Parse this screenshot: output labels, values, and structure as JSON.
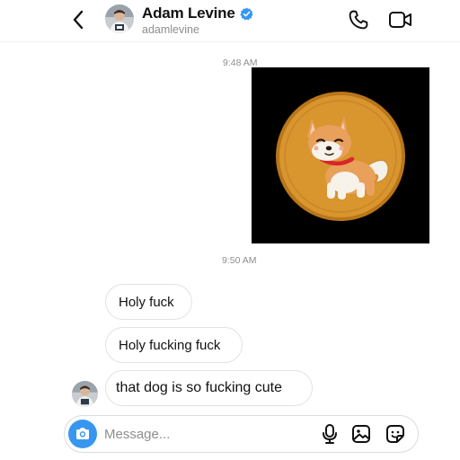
{
  "header": {
    "name": "Adam Levine",
    "username": "adamlevine",
    "verified": true,
    "icons": {
      "back": "chevron-left-icon",
      "verified": "verified-badge-icon",
      "call": "phone-icon",
      "video": "video-camera-icon"
    }
  },
  "conversation": {
    "timestamps": [
      "9:48 AM",
      "9:50 AM"
    ],
    "image_message": {
      "description_icon": "shiba-inu-coin-image"
    },
    "messages": [
      {
        "text": "Holy fuck"
      },
      {
        "text": "Holy fucking fuck"
      },
      {
        "text": "that dog is so fucking cute"
      }
    ]
  },
  "composer": {
    "placeholder": "Message...",
    "value": "",
    "icons": {
      "camera": "camera-icon",
      "mic": "microphone-icon",
      "gallery": "image-gallery-icon",
      "sticker": "sticker-icon"
    }
  },
  "colors": {
    "accent": "#3797f0",
    "verified": "#3797f0",
    "coin_gold": "#d9952e",
    "coin_rim": "#b9761a",
    "collar_red": "#d6262b"
  }
}
